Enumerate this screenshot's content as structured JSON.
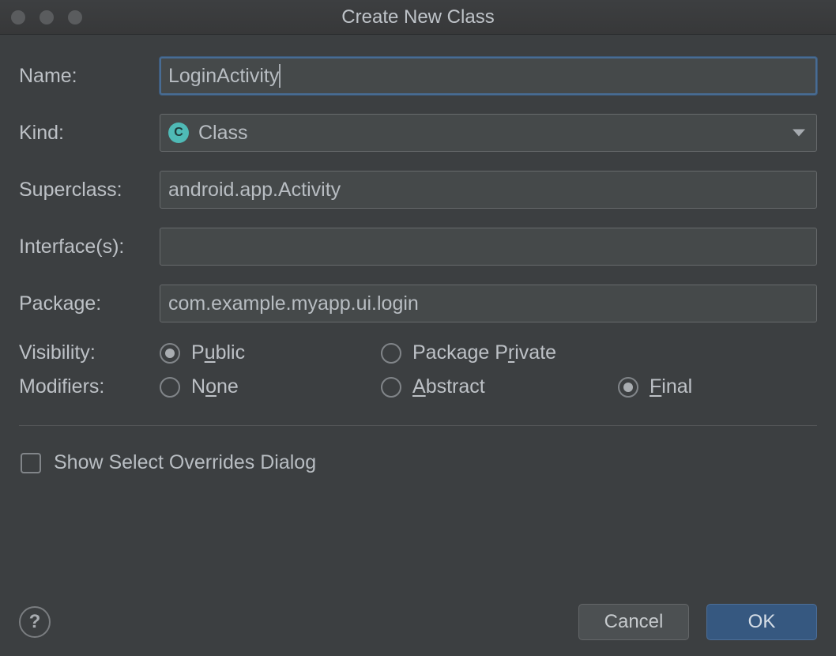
{
  "window": {
    "title": "Create New Class"
  },
  "labels": {
    "name": "Name:",
    "kind": "Kind:",
    "superclass": "Superclass:",
    "interfaces": "Interface(s):",
    "package": "Package:",
    "visibility": "Visibility:",
    "modifiers": "Modifiers:"
  },
  "fields": {
    "name_value": "LoginActivity",
    "kind_value": "Class",
    "kind_badge": "C",
    "superclass_value": "android.app.Activity",
    "interfaces_value": "",
    "package_value": "com.example.myapp.ui.login"
  },
  "visibility": {
    "public_pre": "P",
    "public_mn": "u",
    "public_post": "blic",
    "pkgpriv_pre": "Package P",
    "pkgpriv_mn": "r",
    "pkgpriv_post": "ivate"
  },
  "modifiers": {
    "none_pre": "N",
    "none_mn": "o",
    "none_post": "ne",
    "abstract_pre": "",
    "abstract_mn": "A",
    "abstract_post": "bstract",
    "final_pre": "",
    "final_mn": "F",
    "final_post": "inal"
  },
  "checkbox": {
    "overrides_label": "Show Select Overrides Dialog"
  },
  "buttons": {
    "cancel": "Cancel",
    "ok": "OK",
    "help": "?"
  }
}
